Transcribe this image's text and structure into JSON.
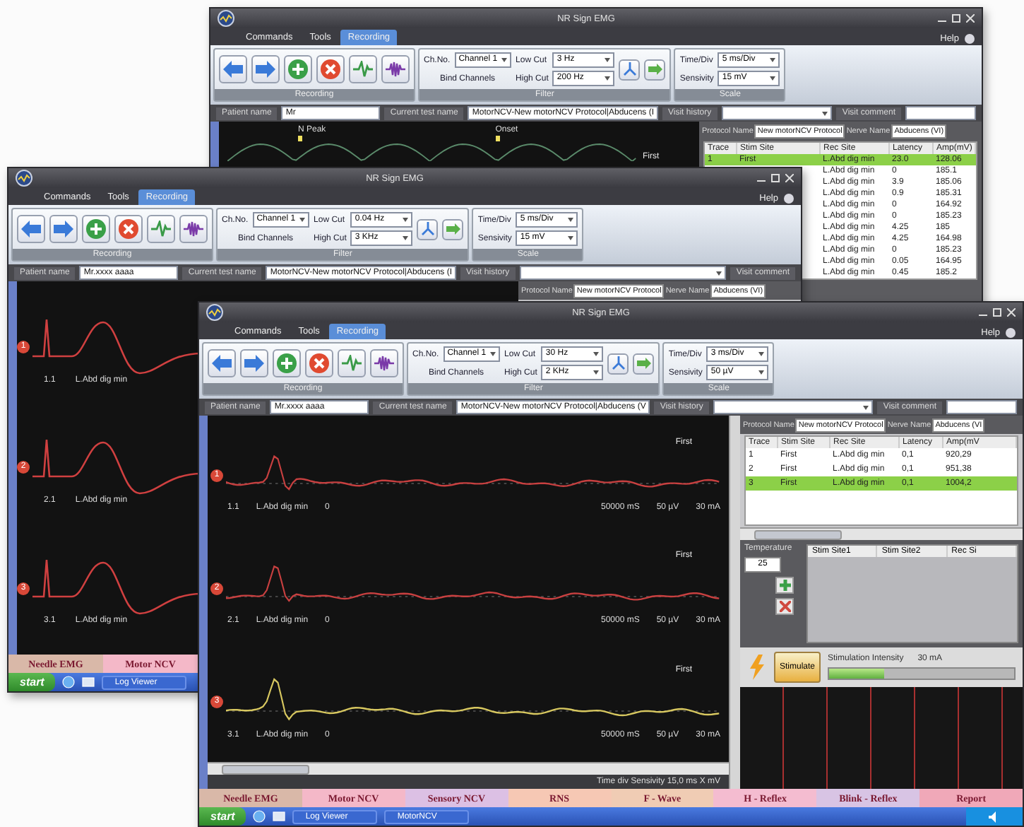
{
  "windows": [
    {
      "title": "NR Sign EMG",
      "help": "Help",
      "menus": [
        {
          "label": "Commands",
          "selected": false
        },
        {
          "label": "Tools",
          "selected": false
        },
        {
          "label": "Recording",
          "selected": true
        }
      ],
      "toolbar": {
        "caption": "Recording",
        "buttons": [
          {
            "kind": "back"
          },
          {
            "kind": "forward"
          },
          {
            "kind": "add"
          },
          {
            "kind": "delete"
          },
          {
            "kind": "wave"
          },
          {
            "kind": "burst"
          }
        ]
      },
      "filter": {
        "ch_label": "Ch.No.",
        "channel": "Channel 1",
        "bind": "Bind Channels",
        "low_label": "Low Cut",
        "low": "3 Hz",
        "high_label": "High Cut",
        "high": "200 Hz",
        "caption": "Filter"
      },
      "scale": {
        "time_label": "Time/Div",
        "time": "5 ms/Div",
        "sens_label": "Sensivity",
        "sens": "15 mV",
        "caption": "Scale"
      },
      "info": [
        {
          "kind": "field",
          "label": "Patient name",
          "value": "Mr"
        },
        {
          "kind": "field",
          "label": "Current test name",
          "value": "MotorNCV-New motorNCV Protocol|Abducens (I"
        },
        {
          "kind": "dropdown",
          "label": "Visit history"
        },
        {
          "kind": "field",
          "label": "Visit comment"
        }
      ],
      "graph": {
        "kind": "peaks",
        "markers": [
          "N Peak",
          "Onset"
        ],
        "flag": "First"
      },
      "panel": {
        "protocol": {
          "name_label": "Protocol Name",
          "name": "New motorNCV Protocol",
          "nerve_label": "Nerve Name",
          "nerve": "Abducens (VI)"
        },
        "table": {
          "columns": [
            "Trace",
            "Stim Site",
            "Rec Site",
            "Latency",
            "Amp(mV)"
          ],
          "rows": [
            {
              "trace": "1",
              "stim": "First",
              "rec": "L.Abd dig min",
              "latency": "23.0",
              "amp": "128.06",
              "selected": true
            },
            {
              "rec": "L.Abd dig min",
              "latency": "0",
              "amp": "185.1",
              "selected": false
            },
            {
              "rec": "L.Abd dig min",
              "latency": "3.9",
              "amp": "185.06",
              "selected": false
            },
            {
              "rec": "L.Abd dig min",
              "latency": "0.9",
              "amp": "185.31",
              "selected": false
            },
            {
              "rec": "L.Abd dig min",
              "latency": "0",
              "amp": "164.92",
              "selected": false
            },
            {
              "rec": "L.Abd dig min",
              "latency": "0",
              "amp": "185.23",
              "selected": false
            },
            {
              "rec": "L.Abd dig min",
              "latency": "4.25",
              "amp": "185",
              "selected": false
            },
            {
              "rec": "L.Abd dig min",
              "latency": "4.25",
              "amp": "164.98",
              "selected": false
            },
            {
              "rec": "L.Abd dig min",
              "latency": "0",
              "amp": "185.23",
              "selected": false
            },
            {
              "rec": "L.Abd dig min",
              "latency": "0.05",
              "amp": "164.95",
              "selected": false
            },
            {
              "rec": "L.Abd dig min",
              "latency": "0.45",
              "amp": "185.2",
              "selected": false
            }
          ]
        }
      }
    },
    {
      "title": "NR Sign EMG",
      "help": "Help",
      "menus": [
        {
          "label": "Commands",
          "selected": false
        },
        {
          "label": "Tools",
          "selected": false
        },
        {
          "label": "Recording",
          "selected": true
        }
      ],
      "toolbar": {
        "caption": "Recording",
        "buttons": [
          {
            "kind": "back"
          },
          {
            "kind": "forward"
          },
          {
            "kind": "add"
          },
          {
            "kind": "delete"
          },
          {
            "kind": "wave"
          },
          {
            "kind": "burst"
          }
        ]
      },
      "filter": {
        "ch_label": "Ch.No.",
        "channel": "Channel 1",
        "bind": "Bind Channels",
        "low_label": "Low Cut",
        "low": "0.04 Hz",
        "high_label": "High Cut",
        "high": "3 KHz",
        "caption": "Filter"
      },
      "scale": {
        "time_label": "Time/Div",
        "time": "5 ms/Div",
        "sens_label": "Sensivity",
        "sens": "15 mV",
        "caption": "Scale"
      },
      "info": [
        {
          "kind": "field",
          "label": "Patient name",
          "value": "Mr.xxxx aaaa"
        },
        {
          "kind": "field",
          "label": "Current test name",
          "value": "MotorNCV-New motorNCV Protocol|Abducens (I"
        },
        {
          "kind": "dropdown",
          "label": "Visit history"
        },
        {
          "kind": "label",
          "label": "Visit comment"
        }
      ],
      "graph": {
        "kind": "responses",
        "traces": [
          {
            "badge": "1",
            "id": "1.1",
            "site": "L.Abd dig min"
          },
          {
            "badge": "2",
            "id": "2.1",
            "site": "L.Abd dig min"
          },
          {
            "badge": "3",
            "id": "3.1",
            "site": "L.Abd dig min"
          }
        ]
      },
      "panel": {
        "protocol": {
          "name_label": "Protocol Name",
          "name": "New motorNCV Protocol",
          "nerve_label": "Nerve Name",
          "nerve": "Abducens (VI)"
        }
      },
      "tabs": [
        {
          "label": "Needle EMG",
          "color": "#d9b8a8"
        },
        {
          "label": "Motor NCV",
          "color": "#f4b8c8"
        }
      ],
      "taskbar": {
        "start": "start",
        "tasks": [
          "Log Viewer"
        ]
      }
    },
    {
      "title": "NR Sign EMG",
      "help": "Help",
      "menus": [
        {
          "label": "Commands",
          "selected": false
        },
        {
          "label": "Tools",
          "selected": false
        },
        {
          "label": "Recording",
          "selected": true
        }
      ],
      "toolbar": {
        "caption": "Recording",
        "buttons": [
          {
            "kind": "back"
          },
          {
            "kind": "forward"
          },
          {
            "kind": "add"
          },
          {
            "kind": "delete"
          },
          {
            "kind": "wave"
          },
          {
            "kind": "burst"
          }
        ]
      },
      "filter": {
        "ch_label": "Ch.No.",
        "channel": "Channel 1",
        "bind": "Bind Channels",
        "low_label": "Low Cut",
        "low": "30 Hz",
        "high_label": "High Cut",
        "high": "2 KHz",
        "caption": "Filter"
      },
      "scale": {
        "time_label": "Time/Div",
        "time": "3 ms/Div",
        "sens_label": "Sensivity",
        "sens": "50 µV",
        "caption": "Scale"
      },
      "info": [
        {
          "kind": "field",
          "label": "Patient name",
          "value": "Mr.xxxx aaaa"
        },
        {
          "kind": "field",
          "label": "Current test name",
          "value": "MotorNCV-New motorNCV Protocol|Abducens (V"
        },
        {
          "kind": "dropdown",
          "label": "Visit history"
        },
        {
          "kind": "field",
          "label": "Visit comment"
        }
      ],
      "graph": {
        "kind": "traces",
        "status": "Time div Sensivity 15,0 ms X mV",
        "traces": [
          {
            "badge": "1",
            "flag": "First",
            "id": "1.1",
            "site": "L.Abd dig min",
            "zero": "0",
            "time": "50000 mS",
            "gain": "50 µV",
            "current": "30 mA",
            "color": "#c84040"
          },
          {
            "badge": "2",
            "flag": "First",
            "id": "2.1",
            "site": "L.Abd dig min",
            "zero": "0",
            "time": "50000 mS",
            "gain": "50 µV",
            "current": "30 mA",
            "color": "#c84040"
          },
          {
            "badge": "3",
            "flag": "First",
            "id": "3.1",
            "site": "L.Abd dig min",
            "zero": "0",
            "time": "50000 mS",
            "gain": "50 µV",
            "current": "30 mA",
            "color": "#d8c860"
          }
        ]
      },
      "panel": {
        "protocol": {
          "name_label": "Protocol Name",
          "name": "New motorNCV Protocol",
          "nerve_label": "Nerve Name",
          "nerve": "Abducens (VI"
        },
        "table": {
          "columns": [
            "Trace",
            "Stim Site",
            "Rec Site",
            "Latency",
            "Amp(mV"
          ],
          "rows": [
            {
              "trace": "1",
              "stim": "First",
              "rec": "L.Abd dig min",
              "latency": "0,1",
              "amp": "920,29",
              "selected": false
            },
            {
              "trace": "2",
              "stim": "First",
              "rec": "L.Abd dig min",
              "latency": "0,1",
              "amp": "951,38",
              "selected": false
            },
            {
              "trace": "3",
              "stim": "First",
              "rec": "L.Abd dig min",
              "latency": "0,1",
              "amp": "1004,2",
              "selected": true
            }
          ]
        },
        "temperature": {
          "label": "Temperature",
          "value": "25"
        },
        "sites": {
          "columns": [
            "Stim Site1",
            "Stim Site2",
            "Rec Si"
          ]
        },
        "stimulation": {
          "button": "Stimulate",
          "label": "Stimulation Intensity",
          "value": "30 mA",
          "level": 0.3
        }
      },
      "tabs": [
        {
          "label": "Needle EMG",
          "color": "#d9b8a8"
        },
        {
          "label": "Motor NCV",
          "color": "#f4b8c8"
        },
        {
          "label": "Sensory NCV",
          "color": "#dcc0e4"
        },
        {
          "label": "RNS",
          "color": "#f6c8b4"
        },
        {
          "label": "F - Wave",
          "color": "#f0ccb4"
        },
        {
          "label": "H - Reflex",
          "color": "#f4bcd0"
        },
        {
          "label": "Blink - Reflex",
          "color": "#d8c4e4"
        },
        {
          "label": "Report",
          "color": "#f0a8b8"
        }
      ],
      "taskbar": {
        "start": "start",
        "tasks": [
          "Log Viewer",
          "MotorNCV"
        ]
      }
    }
  ]
}
